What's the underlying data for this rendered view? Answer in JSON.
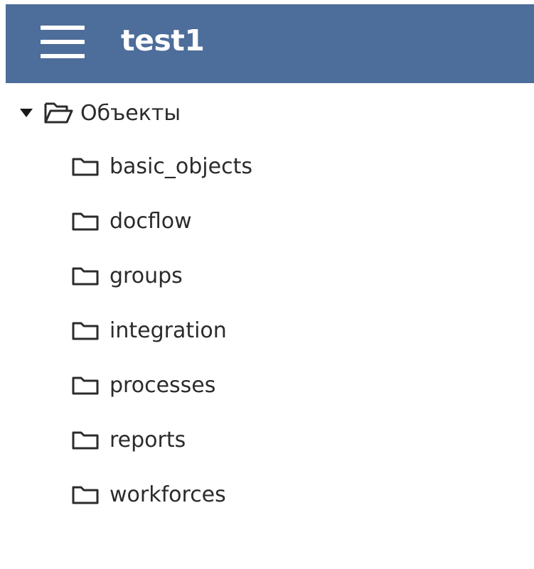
{
  "header": {
    "title": "test1",
    "menu_icon": "hamburger-menu-icon",
    "background": "#4d6d9a"
  },
  "tree": {
    "root": {
      "label": "Объекты",
      "expanded": true,
      "icon": "folder-open-icon"
    },
    "children": [
      {
        "label": "basic_objects",
        "icon": "folder-icon"
      },
      {
        "label": "docflow",
        "icon": "folder-icon"
      },
      {
        "label": "groups",
        "icon": "folder-icon"
      },
      {
        "label": "integration",
        "icon": "folder-icon"
      },
      {
        "label": "processes",
        "icon": "folder-icon"
      },
      {
        "label": "reports",
        "icon": "folder-icon"
      },
      {
        "label": "workforces",
        "icon": "folder-icon"
      }
    ]
  }
}
